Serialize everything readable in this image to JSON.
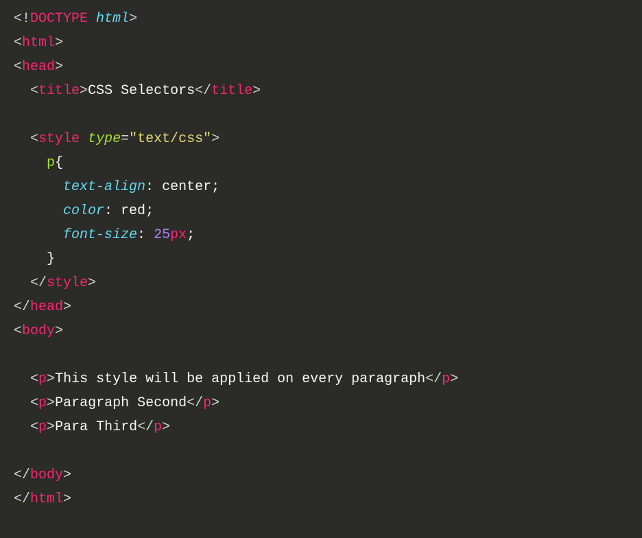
{
  "code": {
    "doctype": {
      "excl": "<!",
      "kw": "DOCTYPE",
      "html": "html",
      "close": ">"
    },
    "html_open": {
      "lt": "<",
      "tag": "html",
      "gt": ">"
    },
    "head_open": {
      "lt": "<",
      "tag": "head",
      "gt": ">"
    },
    "title_open": {
      "lt": "<",
      "tag": "title",
      "gt": ">"
    },
    "title_text": "CSS Selectors",
    "title_close": {
      "lt": "</",
      "tag": "title",
      "gt": ">"
    },
    "style_open": {
      "lt": "<",
      "tag": "style",
      "attr": "type",
      "eq": "=",
      "val": "\"text/css\"",
      "gt": ">"
    },
    "css": {
      "selector": "p",
      "brace_open": "{",
      "rules": [
        {
          "prop": "text-align",
          "colon": ":",
          "value": " center",
          "semi": ";"
        },
        {
          "prop": "color",
          "colon": ":",
          "value": " red",
          "semi": ";"
        },
        {
          "prop": "font-size",
          "colon": ":",
          "number": " 25",
          "unit": "px",
          "semi": ";"
        }
      ],
      "brace_close": "}"
    },
    "style_close": {
      "lt": "</",
      "tag": "style",
      "gt": ">"
    },
    "head_close": {
      "lt": "</",
      "tag": "head",
      "gt": ">"
    },
    "body_open": {
      "lt": "<",
      "tag": "body",
      "gt": ">"
    },
    "paragraphs": [
      {
        "lt": "<",
        "tag": "p",
        "gt": ">",
        "text": "This style will be applied on every paragraph",
        "clt": "</",
        "ctag": "p",
        "cgt": ">"
      },
      {
        "lt": "<",
        "tag": "p",
        "gt": ">",
        "text": "Paragraph Second",
        "clt": "</",
        "ctag": "p",
        "cgt": ">"
      },
      {
        "lt": "<",
        "tag": "p",
        "gt": ">",
        "text": "Para Third",
        "clt": "</",
        "ctag": "p",
        "cgt": ">"
      }
    ],
    "body_close": {
      "lt": "</",
      "tag": "body",
      "gt": ">"
    },
    "html_close": {
      "lt": "</",
      "tag": "html",
      "gt": ">"
    },
    "indent1": "  ",
    "indent2": "    ",
    "indent3": "      "
  }
}
